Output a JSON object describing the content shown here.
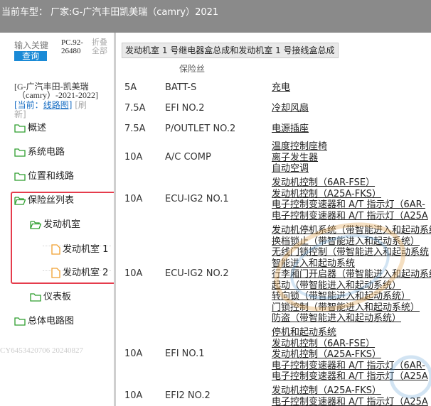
{
  "window": {
    "title": "当前车型： 厂家:G-广汽丰田凯美瑞（camry）2021"
  },
  "sidebar": {
    "search_placeholder": "输入关键",
    "search_button": "查询",
    "version_line1": "PC.92-",
    "version_line2": "26480",
    "fold_line1": "折叠",
    "fold_line2": "全部",
    "model_line1": "[G-广汽丰田-凯美瑞",
    "model_line2": "（camry）-2021-2022]",
    "current_prefix": "[当前：",
    "current_link": "线路图",
    "current_suffix": "]",
    "refresh_line1": "[刷",
    "refresh_line2": "新]",
    "tree": [
      {
        "label": "概述",
        "icon": "folder-icon"
      },
      {
        "label": "系统电路",
        "icon": "folder-icon"
      },
      {
        "label": "位置和线路",
        "icon": "folder-icon"
      },
      {
        "label": "保险丝列表",
        "icon": "folder-open-icon"
      },
      {
        "label": "发动机室",
        "icon": "folder-open-icon"
      },
      {
        "label": "发动机室 1",
        "icon": "file-icon"
      },
      {
        "label": "发动机室 2",
        "icon": "file-icon"
      },
      {
        "label": "仪表板",
        "icon": "folder-icon"
      },
      {
        "label": "总体电路图",
        "icon": "folder-icon"
      }
    ],
    "watermark": "CY6453420706 20240827",
    "highlight_color": "#e53c4c",
    "folder_color": "#2e9e2e",
    "file_color": "#f0a030"
  },
  "main": {
    "section_title": "发动机室 1 号继电器盒总成和发动机室 1 号接线盒总成",
    "column_header": "保险丝",
    "fuses": [
      {
        "amp": "5A",
        "name": "BATT-S",
        "circuits": [
          "充电"
        ]
      },
      {
        "amp": "7.5A",
        "name": "EFI NO.2",
        "circuits": [
          "冷却风扇"
        ]
      },
      {
        "amp": "7.5A",
        "name": "P/OUTLET NO.2",
        "circuits": [
          "电源插座"
        ]
      },
      {
        "amp": "10A",
        "name": "A/C COMP",
        "circuits": [
          "温度控制座椅",
          "离子发生器",
          "自动空调"
        ]
      },
      {
        "amp": "10A",
        "name": "ECU-IG2 NO.1",
        "circuits": [
          "发动机控制（6AR-FSE）",
          "发动机控制（A25A-FKS）",
          "电子控制变速器和 A/T 指示灯（6AR-",
          "电子控制变速器和 A/T 指示灯（A25A"
        ]
      },
      {
        "amp": "10A",
        "name": "ECU-IG2 NO.2",
        "circuits": [
          "发动机停机系统（带智能进入和起动系统",
          "换档锁止（带智能进入和起动系统）",
          "无线门锁控制（带智能进入和起动系统",
          "智能进入和起动系统",
          "行李厢门开启器（带智能进入和起动系统",
          "起动（带智能进入和起动系统）",
          "转向锁（带智能进入和起动系统）",
          "门锁控制（带智能进入和起动系统）",
          "防盗（带智能进入和起动系统）"
        ]
      },
      {
        "amp": "10A",
        "name": "EFI NO.1",
        "circuits": [
          "停机和起动系统",
          "发动机控制（6AR-FSE）",
          "发动机控制（A25A-FKS）",
          "电子控制变速器和 A/T 指示灯（6AR-",
          "电子控制变速器和 A/T 指示灯（A25A"
        ]
      },
      {
        "amp": "10A",
        "name": "EFI2 NO.2",
        "circuits": [
          "发动机控制（A25A-FKS）",
          "电子控制变速器和 A/T 指示灯（A25A"
        ]
      }
    ]
  }
}
